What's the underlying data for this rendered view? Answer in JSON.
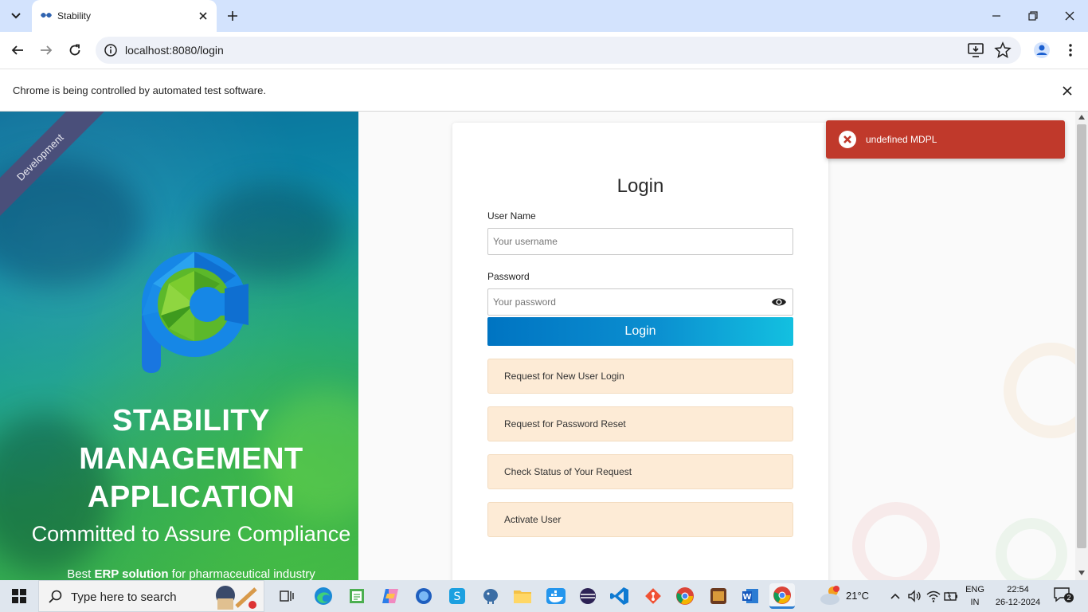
{
  "browser": {
    "tab_title": "Stability",
    "url": "localhost:8080/login",
    "automation_notice": "Chrome is being controlled by automated test software."
  },
  "branding": {
    "ribbon_label": "Development",
    "app_title_line1": "STABILITY",
    "app_title_line2": "MANAGEMENT",
    "app_title_line3": "APPLICATION",
    "tagline": "Committed to Assure Compliance",
    "sub_prefix": "Best ",
    "sub_bold": "ERP solution",
    "sub_suffix": " for pharmaceutical industry"
  },
  "login": {
    "title": "Login",
    "username_label": "User Name",
    "username_placeholder": "Your username",
    "password_label": "Password",
    "password_placeholder": "Your password",
    "submit_label": "Login",
    "links": [
      "Request for New User Login",
      "Request for Password Reset",
      "Check Status of Your Request",
      "Activate User"
    ]
  },
  "toast": {
    "message": "undefined MDPL",
    "color": "#c0392b"
  },
  "taskbar": {
    "search_placeholder": "Type here to search",
    "weather": "21°C",
    "lang_line1": "ENG",
    "lang_line2": "IN",
    "time": "22:54",
    "date": "26-12-2024",
    "notification_count": "2"
  },
  "colors": {
    "login_button_start": "#0074c2",
    "login_button_end": "#13c0e0",
    "request_button_bg": "#fdebd6",
    "tabstrip_bg": "#d3e3fd"
  }
}
